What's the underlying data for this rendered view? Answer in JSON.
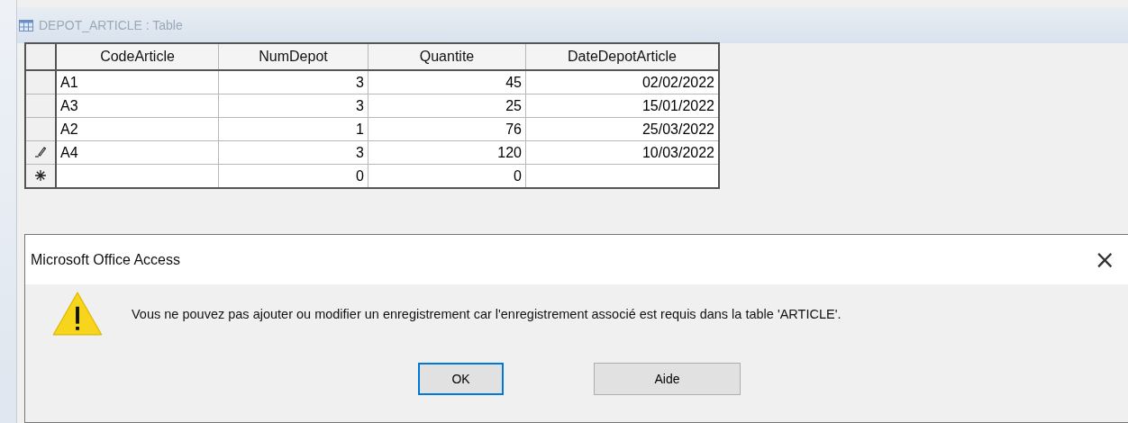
{
  "window": {
    "title": "DEPOT_ARTICLE : Table"
  },
  "table": {
    "columns": [
      "CodeArticle",
      "NumDepot",
      "Quantite",
      "DateDepotArticle"
    ],
    "rows": [
      {
        "kind": "record",
        "code": "A1",
        "num_depot": "3",
        "quantite": "45",
        "date": "02/02/2022"
      },
      {
        "kind": "record",
        "code": "A3",
        "num_depot": "3",
        "quantite": "25",
        "date": "15/01/2022"
      },
      {
        "kind": "record",
        "code": "A2",
        "num_depot": "1",
        "quantite": "76",
        "date": "25/03/2022"
      },
      {
        "kind": "editing",
        "code": "A4",
        "num_depot": "3",
        "quantite": "120",
        "date": "10/03/2022"
      },
      {
        "kind": "new",
        "num_depot": "0",
        "quantite": "0"
      }
    ]
  },
  "dialog": {
    "title": "Microsoft Office Access",
    "close": "×",
    "message": "Vous ne pouvez pas ajouter ou modifier un enregistrement car l'enregistrement associé est requis dans la table 'ARTICLE'.",
    "buttons": [
      {
        "label": "OK",
        "selected": true
      },
      {
        "label": "Aide",
        "selected": false
      }
    ]
  }
}
